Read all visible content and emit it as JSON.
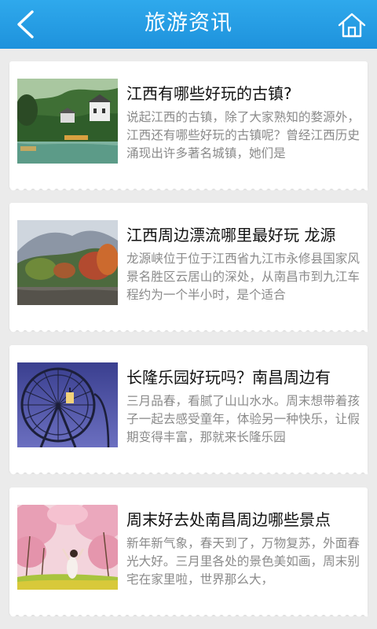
{
  "header": {
    "title": "旅游资讯",
    "back_icon": "back-arrow-icon",
    "home_icon": "home-icon",
    "color": "#2a9fe6"
  },
  "articles": [
    {
      "title": "江西有哪些好玩的古镇?",
      "desc": "说起江西的古镇，除了大家熟知的婺源外，江西还有哪些好玩的古镇呢？曾经江西历史涌现出许多著名城镇，她们是",
      "image": "ancient-town-photo"
    },
    {
      "title": "江西周边漂流哪里最好玩 龙源",
      "desc": "龙源峡位于位于江西省九江市永修县国家风景名胜区云居山的深处，从南昌市到九江车程约为一个半小时，是个适合",
      "image": "mountain-lake-photo"
    },
    {
      "title": "长隆乐园好玩吗？南昌周边有",
      "desc": "三月品春，看腻了山山水水。周末想带着孩子一起去感受童年，体验另一种快乐，让假期变得丰富，那就来长隆乐园",
      "image": "ferris-wheel-photo"
    },
    {
      "title": "周末好去处南昌周边哪些景点",
      "desc": "新年新气象，春天到了，万物复苏，外面春光大好。三月里各处的景色美如画，周末别宅在家里啦，世界那么大，",
      "image": "peach-blossom-photo"
    }
  ]
}
